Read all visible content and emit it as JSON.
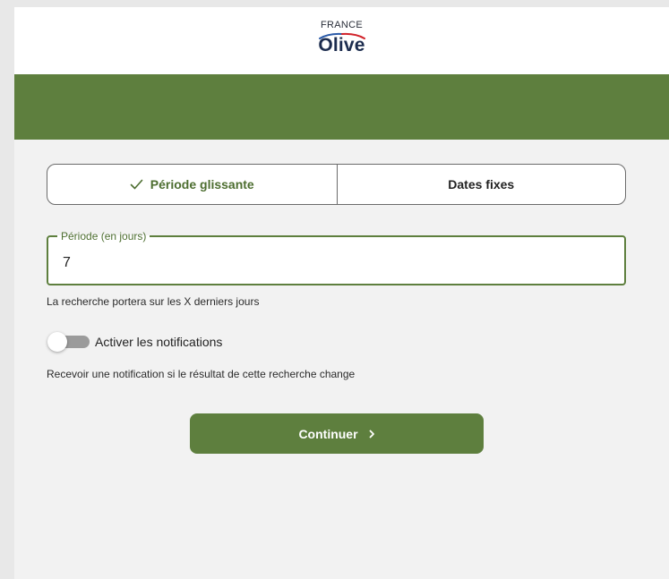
{
  "header": {
    "logo_line1": "FRANCE",
    "logo_line2": "Olive"
  },
  "mode_tabs": [
    {
      "label": "Période glissante",
      "selected": true,
      "icon": "check-icon"
    },
    {
      "label": "Dates fixes",
      "selected": false
    }
  ],
  "period_field": {
    "legend": "Période (en jours)",
    "value": "7",
    "helper_text": "La recherche portera sur les X derniers jours"
  },
  "notifications": {
    "label": "Activer les notifications",
    "enabled": false,
    "description": "Recevoir une notification si le résultat de cette recherche change"
  },
  "continue_button": {
    "label": "Continuer",
    "icon": "chevron-right-icon"
  },
  "colors": {
    "brand_green": "#5e7f3e",
    "page_background": "#f2f2f2",
    "header_background": "#ffffff",
    "logo_navy": "#1c2c4e",
    "logo_red": "#d2232a",
    "logo_blue": "#2a5aa8"
  }
}
